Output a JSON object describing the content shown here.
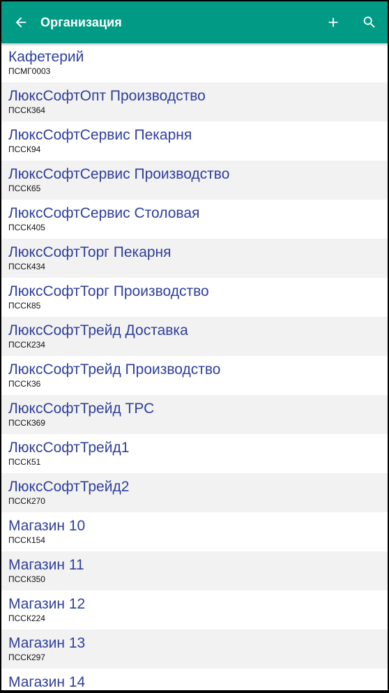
{
  "appbar": {
    "title": "Организация",
    "background": "#009a85",
    "icons": {
      "back": "arrow-back-icon",
      "add": "add-icon",
      "search": "search-icon"
    }
  },
  "list": {
    "name_color": "#2f3f9c",
    "items": [
      {
        "name": "Кафетерий",
        "code": "ПСМГ0003"
      },
      {
        "name": "ЛюксСофтОпт Производство",
        "code": "ПССК364"
      },
      {
        "name": "ЛюксСофтСервис Пекарня",
        "code": "ПССК94"
      },
      {
        "name": "ЛюксСофтСервис Производство",
        "code": "ПССК65"
      },
      {
        "name": "ЛюксСофтСервис Столовая",
        "code": "ПССК405"
      },
      {
        "name": "ЛюксСофтТорг Пекарня",
        "code": "ПССК434"
      },
      {
        "name": "ЛюксСофтТорг Производство",
        "code": "ПССК85"
      },
      {
        "name": "ЛюксСофтТрейд Доставка",
        "code": "ПССК234"
      },
      {
        "name": "ЛюксСофтТрейд Производство",
        "code": "ПССК36"
      },
      {
        "name": "ЛюксСофтТрейд ТРС",
        "code": "ПССК369"
      },
      {
        "name": "ЛюксСофтТрейд1",
        "code": "ПССК51"
      },
      {
        "name": "ЛюксСофтТрейд2",
        "code": "ПССК270"
      },
      {
        "name": "Магазин 10",
        "code": "ПССК154"
      },
      {
        "name": "Магазин 11",
        "code": "ПССК350"
      },
      {
        "name": "Магазин 12",
        "code": "ПССК224"
      },
      {
        "name": "Магазин 13",
        "code": "ПССК297"
      },
      {
        "name": "Магазин 14",
        "code": ""
      }
    ]
  }
}
